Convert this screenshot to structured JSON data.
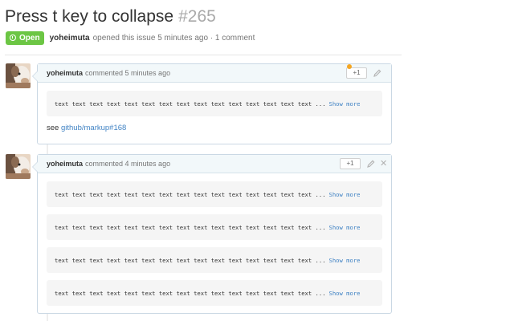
{
  "issue": {
    "title": "Press t key to collapse",
    "number": "#265",
    "state_label": "Open",
    "author": "yoheimuta",
    "opened_text": "opened this issue 5 minutes ago · 1 comment",
    "state_color": "#6cc644"
  },
  "comments": [
    {
      "author": "yoheimuta",
      "meta": "commented 5 minutes ago",
      "reaction_label": "+1",
      "code_blocks": [
        {
          "text": "text text text text text text text text text text text text text text text ...",
          "show_more": "Show more"
        }
      ],
      "body_prefix": "see ",
      "body_link": "github/markup#168"
    },
    {
      "author": "yoheimuta",
      "meta": "commented 4 minutes ago",
      "reaction_label": "+1",
      "code_blocks": [
        {
          "text": "text text text text text text text text text text text text text text text ...",
          "show_more": "Show more"
        },
        {
          "text": "text text text text text text text text text text text text text text text ...",
          "show_more": "Show more"
        },
        {
          "text": "text text text text text text text text text text text text text text text ...",
          "show_more": "Show more"
        },
        {
          "text": "text text text text text text text text text text text text text text text ...",
          "show_more": "Show more"
        }
      ]
    }
  ],
  "icons": {
    "state": "issue-opened-icon",
    "edit": "pencil-icon",
    "delete": "close-icon",
    "notification": "notification-dot-icon"
  },
  "colors": {
    "link": "#4183c4",
    "comment_border": "#cad8e4",
    "header_bg": "#f2f8fa",
    "code_bg": "#f5f5f5"
  }
}
